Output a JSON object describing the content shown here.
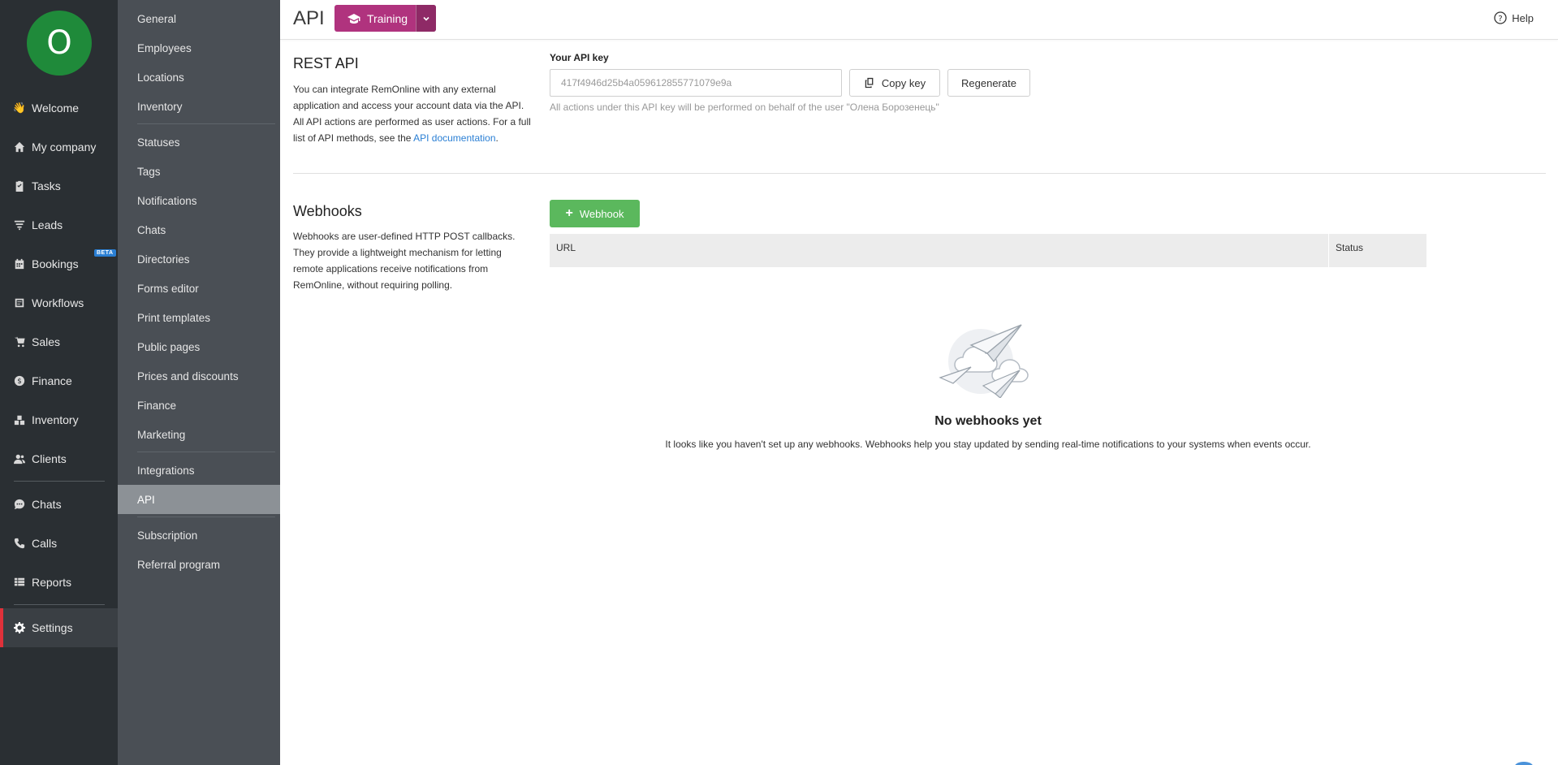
{
  "nav": {
    "avatar_letter": "O",
    "items": [
      {
        "label": "Welcome",
        "icon": "wave-hand-icon"
      },
      {
        "label": "My company",
        "icon": "home-icon"
      },
      {
        "label": "Tasks",
        "icon": "clipboard-check-icon"
      },
      {
        "label": "Leads",
        "icon": "funnel-icon"
      },
      {
        "label": "Bookings",
        "icon": "calendar-icon",
        "badge": "BETA"
      },
      {
        "label": "Workflows",
        "icon": "workflow-icon"
      },
      {
        "label": "Sales",
        "icon": "cart-icon"
      },
      {
        "label": "Finance",
        "icon": "dollar-icon"
      },
      {
        "label": "Inventory",
        "icon": "boxes-icon"
      },
      {
        "label": "Clients",
        "icon": "users-icon"
      },
      {
        "label": "Chats",
        "icon": "chat-icon"
      },
      {
        "label": "Calls",
        "icon": "phone-icon"
      },
      {
        "label": "Reports",
        "icon": "table-icon"
      },
      {
        "label": "Settings",
        "icon": "gear-icon"
      }
    ]
  },
  "settings_menu": {
    "items": [
      "General",
      "Employees",
      "Locations",
      "Inventory",
      "Statuses",
      "Tags",
      "Notifications",
      "Chats",
      "Directories",
      "Forms editor",
      "Print templates",
      "Public pages",
      "Prices and discounts",
      "Finance",
      "Marketing",
      "Integrations",
      "API",
      "Subscription",
      "Referral program"
    ],
    "active": "API"
  },
  "header": {
    "title": "API",
    "training_label": "Training",
    "help_label": "Help"
  },
  "rest_api": {
    "title": "REST API",
    "desc_part1": "You can integrate RemOnline with any external application and access your account data via the API. All API actions are performed as user actions. For a full list of API methods, see the ",
    "desc_link": "API documentation",
    "desc_part2": ".",
    "key_label": "Your API key",
    "key_value": "417f4946d25b4a059612855771079e9a",
    "copy_label": "Copy key",
    "regenerate_label": "Regenerate",
    "note": "All actions under this API key will be performed on behalf of the user \"Олена Борозенець\""
  },
  "webhooks": {
    "title": "Webhooks",
    "desc": "Webhooks are user-defined HTTP POST callbacks. They provide a lightweight mechanism for letting remote applications receive notifications from RemOnline, without requiring polling.",
    "add_label": "Webhook",
    "columns": [
      "URL",
      "Status"
    ],
    "empty_title": "No webhooks yet",
    "empty_desc": "It looks like you haven't set up any webhooks. Webhooks help you stay updated by sending real-time notifications to your systems when events occur."
  },
  "colors": {
    "nav_bg": "#2a2f33",
    "submenu_bg": "#4a4f55",
    "active_accent": "#e0313a",
    "training": "#b0337e",
    "green": "#5bb85d",
    "link": "#2a7fd4"
  }
}
